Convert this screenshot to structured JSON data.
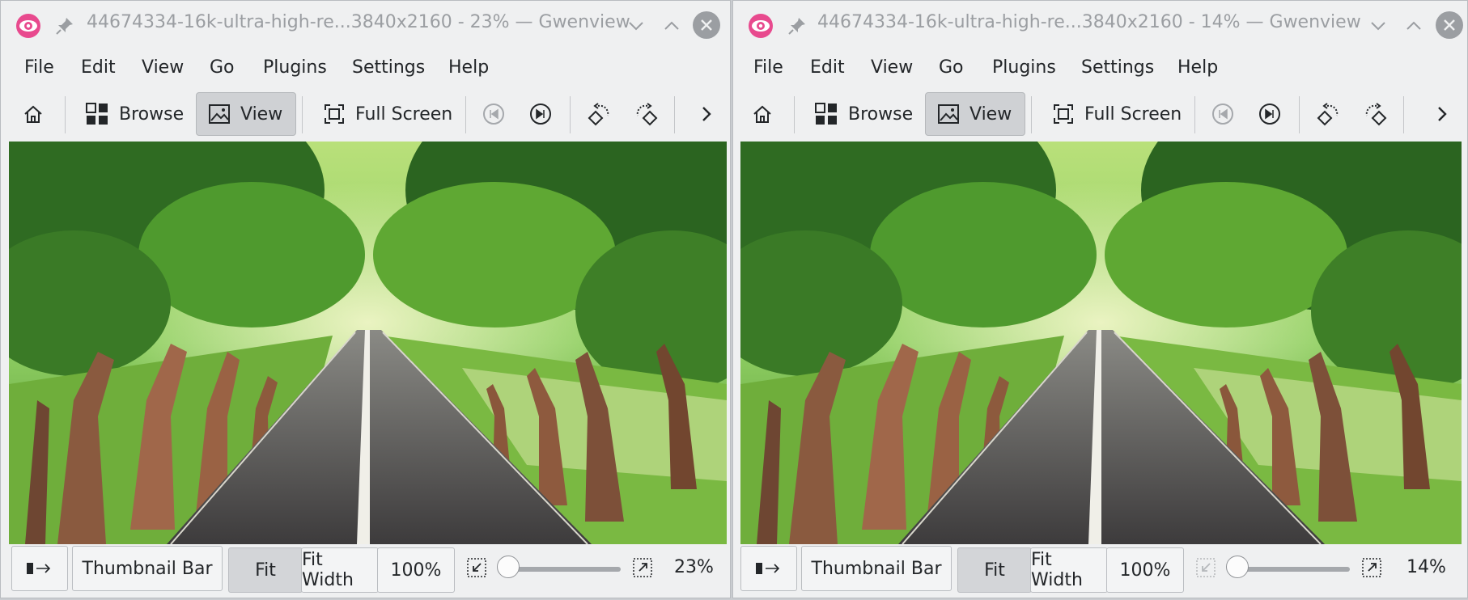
{
  "windows": [
    {
      "title": "44674334-16k-ultra-high-re...3840x2160 - 23% — Gwenview",
      "menu": [
        "File",
        "Edit",
        "View",
        "Go",
        "Plugins",
        "Settings",
        "Help"
      ],
      "toolbar": {
        "browse": "Browse",
        "view": "View",
        "fullscreen": "Full Screen"
      },
      "status": {
        "thumbnail_bar": "Thumbnail Bar",
        "fit": "Fit",
        "fit_width": "Fit Width",
        "hundred": "100%",
        "zoom": "23%"
      }
    },
    {
      "title": "44674334-16k-ultra-high-re...3840x2160 - 14% — Gwenview",
      "menu": [
        "File",
        "Edit",
        "View",
        "Go",
        "Plugins",
        "Settings",
        "Help"
      ],
      "toolbar": {
        "browse": "Browse",
        "view": "View",
        "fullscreen": "Full Screen"
      },
      "status": {
        "thumbnail_bar": "Thumbnail Bar",
        "fit": "Fit",
        "fit_width": "Fit Width",
        "hundred": "100%",
        "zoom": "14%"
      }
    }
  ],
  "icons": {
    "app": "gwenview-app-icon",
    "pin": "pin-icon",
    "minimize": "chevron-down-icon",
    "maximize": "chevron-up-icon",
    "close": "close-icon",
    "home": "home-icon",
    "browse": "grid-icon",
    "view": "image-icon",
    "fullscreen": "fullscreen-icon",
    "prev": "previous-icon",
    "next": "next-icon",
    "rotate_left": "rotate-left-icon",
    "rotate_right": "rotate-right-icon",
    "more": "chevron-right-icon",
    "sidebar": "sidebar-toggle-icon",
    "zoom_out": "zoom-fit-icon",
    "zoom_in": "zoom-in-icon"
  },
  "colors": {
    "accent": "#e84a8e",
    "window_bg": "#eff0f1",
    "active_button": "#cfd1d4"
  }
}
